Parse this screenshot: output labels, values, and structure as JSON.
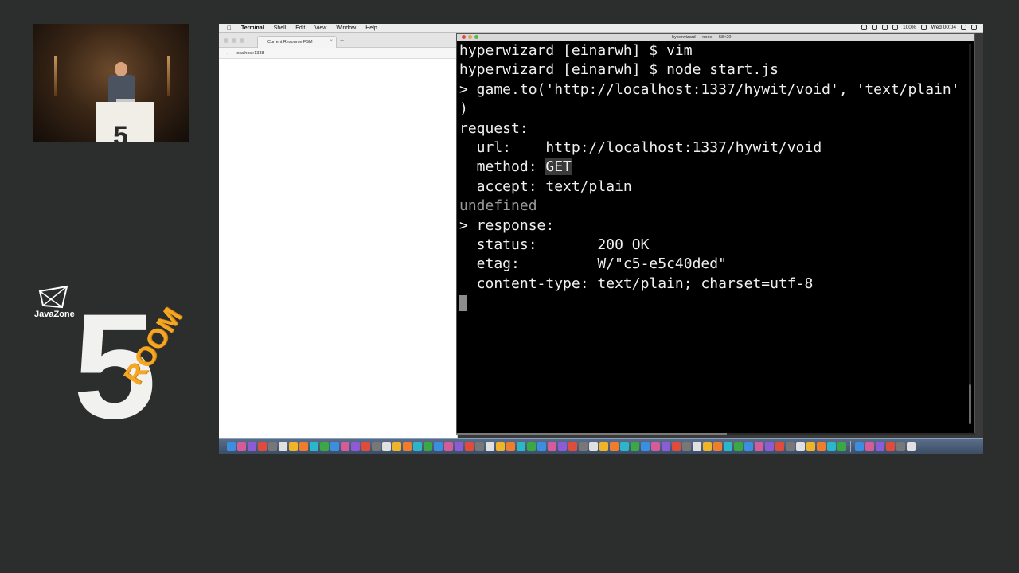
{
  "menubar": {
    "apple": "",
    "items": [
      "Terminal",
      "Shell",
      "Edit",
      "View",
      "Window",
      "Help"
    ],
    "status": {
      "battery": "100%",
      "clock": "Wed 00:04"
    }
  },
  "browser": {
    "tab_title": "Current Resource FSM",
    "tab_close": "×",
    "new_tab": "+",
    "url": "localhost:1338"
  },
  "terminal": {
    "title": "hyperwizard — node — 58×20",
    "lines": [
      "hyperwizard [einarwh] $ vim",
      "hyperwizard [einarwh] $ node start.js",
      "> game.to('http://localhost:1337/hywit/void', 'text/plain'",
      ")",
      "request:",
      "  url:    http://localhost:1337/hywit/void",
      "  method: ",
      "  accept: text/plain",
      "undefined",
      "> response:",
      "  status:       200 OK",
      "  etag:         W/\"c5-e5c40ded\"",
      "  content-type: text/plain; charset=utf-8"
    ],
    "method_value": "GET"
  },
  "branding": {
    "javazone_label": "JavaZone",
    "room_number": "5",
    "room_word": "ROOM"
  },
  "colors": {
    "background": "#2c2e2d",
    "terminal_bg": "#000000",
    "terminal_fg": "#f0f0f0",
    "room_accent": "#f5a623"
  }
}
